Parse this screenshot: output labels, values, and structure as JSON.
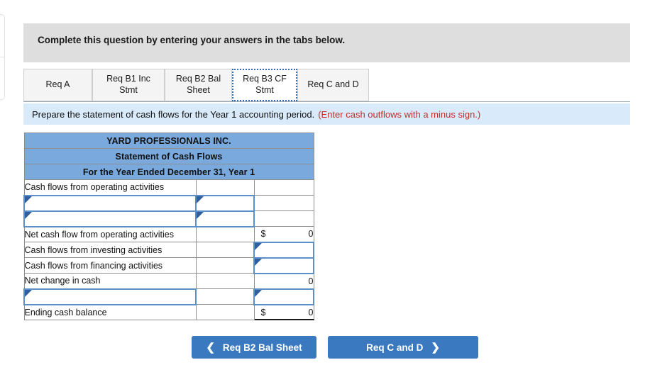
{
  "header": {
    "instruction": "Complete this question by entering your answers in the tabs below."
  },
  "tabs": [
    {
      "label": "Req A",
      "active": false
    },
    {
      "label": "Req B1 Inc\nStmt",
      "line1": "Req B1 Inc",
      "line2": "Stmt",
      "active": false
    },
    {
      "label": "Req B2 Bal\nSheet",
      "line1": "Req B2 Bal",
      "line2": "Sheet",
      "active": false
    },
    {
      "label": "Req B3 CF\nStmt",
      "line1": "Req B3 CF",
      "line2": "Stmt",
      "active": true
    },
    {
      "label": "Req C and D",
      "active": false
    }
  ],
  "prompt": {
    "text": "Prepare the statement of cash flows for the Year 1 accounting period.",
    "note": "(Enter cash outflows with a minus sign.)"
  },
  "statement": {
    "company": "YARD PROFESSIONALS INC.",
    "title": "Statement of Cash Flows",
    "period": "For the Year Ended December 31, Year 1",
    "rows": [
      {
        "label": "Cash flows from operating activities",
        "type": "label",
        "mid": "",
        "value": "",
        "dollar": ""
      },
      {
        "label": "",
        "type": "input-label-mid",
        "mid": "",
        "value": "",
        "dollar": ""
      },
      {
        "label": "",
        "type": "input-label-mid-under",
        "mid": "",
        "value": "",
        "dollar": ""
      },
      {
        "label": "Net cash flow from operating activities",
        "type": "value",
        "mid": "",
        "value": "0",
        "dollar": "$"
      },
      {
        "label": "Cash flows from investing activities",
        "type": "input-value",
        "mid": "",
        "value": "",
        "dollar": ""
      },
      {
        "label": "Cash flows from financing activities",
        "type": "input-value-under",
        "mid": "",
        "value": "",
        "dollar": ""
      },
      {
        "label": "Net change in cash",
        "type": "value",
        "mid": "",
        "value": "0",
        "dollar": ""
      },
      {
        "label": "",
        "type": "input-label-value-under",
        "mid": "",
        "value": "",
        "dollar": ""
      },
      {
        "label": "Ending cash balance",
        "type": "value-double",
        "mid": "",
        "value": "0",
        "dollar": "$"
      }
    ]
  },
  "nav": {
    "prev_label": "Req B2 Bal Sheet",
    "prev_icon": "chevron-left-icon",
    "next_label": "Req C and D",
    "next_icon": "chevron-right-icon"
  },
  "colors": {
    "header_blue": "#7aa9dd",
    "instruction_blue": "#d9eafa",
    "grey": "#dedede",
    "button_blue": "#3a79c0",
    "note_red": "#c42c2c",
    "input_border": "#5b8fc9"
  }
}
